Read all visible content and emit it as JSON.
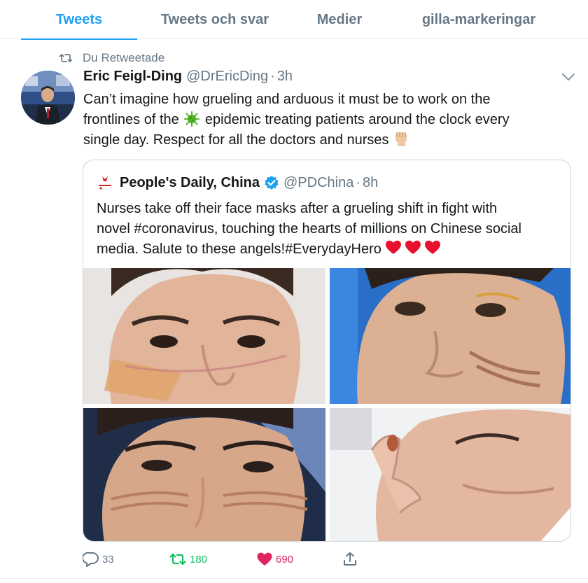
{
  "tabs": [
    {
      "label": "Tweets",
      "active": true
    },
    {
      "label": "Tweets och svar",
      "active": false
    },
    {
      "label": "Medier",
      "active": false
    },
    {
      "label": "gilla-markeringar",
      "active": false
    }
  ],
  "retweet_context": {
    "icon": "retweet-icon",
    "label": "Du Retweetade"
  },
  "tweet": {
    "author_name": "Eric Feigl-Ding",
    "handle": "@DrEricDing",
    "separator": "·",
    "time": "3h",
    "text_lines": [
      "Can’t imagine how grueling and arduous it must be to work on the",
      "frontlines of the",
      "epidemic treating patients around the clock every",
      "single day. Respect for all the doctors and nurses"
    ],
    "inline_emoji": [
      "microbe-emoji",
      "raised-fist-emoji"
    ]
  },
  "quoted_tweet": {
    "author_name": "People's Daily, China",
    "verified": true,
    "handle": "@PDChina",
    "separator": "·",
    "time": "8h",
    "text_lines": [
      "Nurses take off their face masks after a grueling shift in fight with",
      "novel #coronavirus, touching the hearts of millions on Chinese social",
      "media. Salute to these angels!#EverydayHero"
    ],
    "trailing_emoji": [
      "red-heart-emoji",
      "red-heart-emoji",
      "red-heart-emoji"
    ],
    "media": [
      "nurse-photo-1",
      "nurse-photo-2",
      "nurse-photo-3",
      "nurse-photo-4"
    ]
  },
  "actions": {
    "reply_count": "33",
    "retweet_count": "180",
    "like_count": "690"
  },
  "colors": {
    "accent": "#1da1f2",
    "muted": "#657786",
    "retweet_green": "#17bf63",
    "like_red": "#e0245e",
    "border": "#e6ecf0"
  }
}
